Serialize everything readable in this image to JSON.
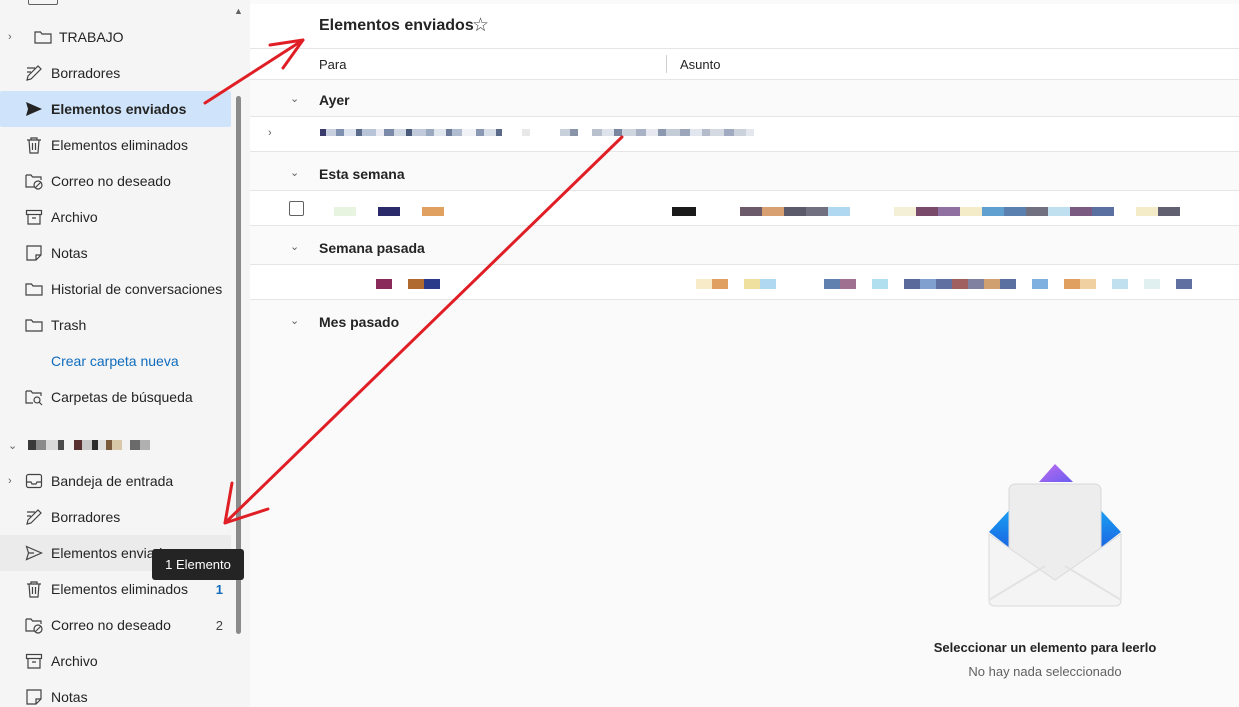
{
  "sidebar": {
    "top_items": [
      {
        "label": "TRABAJO",
        "icon": "folder-icon",
        "expandable": true
      },
      {
        "label": "Borradores",
        "icon": "drafts-icon"
      },
      {
        "label": "Elementos enviados",
        "icon": "send-icon",
        "selected": true
      },
      {
        "label": "Elementos eliminados",
        "icon": "trash-icon"
      },
      {
        "label": "Correo no deseado",
        "icon": "junk-folder-icon"
      },
      {
        "label": "Archivo",
        "icon": "archive-icon"
      },
      {
        "label": "Notas",
        "icon": "notes-icon"
      },
      {
        "label": "Historial de conversaciones",
        "icon": "folder-icon"
      },
      {
        "label": "Trash",
        "icon": "folder-icon"
      },
      {
        "label": "Crear carpeta nueva",
        "icon": "",
        "link": true
      },
      {
        "label": "Carpetas de búsqueda",
        "icon": "search-folder-icon"
      }
    ],
    "bottom_items": [
      {
        "label": "Bandeja de entrada",
        "icon": "inbox-icon",
        "expandable": true,
        "count": ""
      },
      {
        "label": "Borradores",
        "icon": "drafts-icon",
        "count": ""
      },
      {
        "label": "Elementos enviados",
        "icon": "send-icon",
        "count": ""
      },
      {
        "label": "Elementos eliminados",
        "icon": "trash-icon",
        "count": "1"
      },
      {
        "label": "Correo no deseado",
        "icon": "junk-folder-icon",
        "count": "2"
      },
      {
        "label": "Archivo",
        "icon": "archive-icon",
        "count": ""
      },
      {
        "label": "Notas",
        "icon": "notes-icon",
        "count": ""
      }
    ],
    "tooltip": "1 Elemento"
  },
  "main": {
    "title": "Elementos enviados",
    "columns": {
      "to": "Para",
      "subject": "Asunto"
    },
    "groups": [
      "Ayer",
      "Esta semana",
      "Semana pasada",
      "Mes pasado"
    ],
    "empty_state": {
      "title": "Seleccionar un elemento para leerlo",
      "subtitle": "No hay nada seleccionado"
    }
  },
  "colors": {
    "accent": "#0f6cbd",
    "selected_bg": "#cfe4fa",
    "annotation_red": "#e01e25"
  }
}
